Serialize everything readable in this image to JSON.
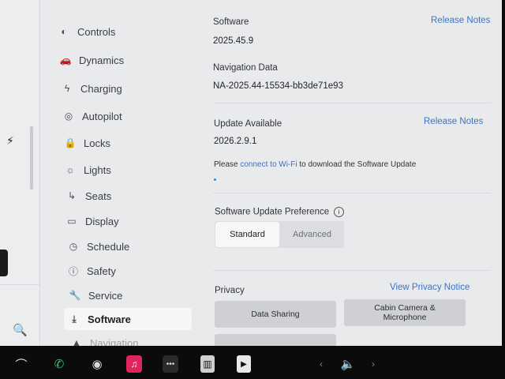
{
  "menu": {
    "items": [
      {
        "label": "Controls",
        "icon": "toggle-icon"
      },
      {
        "label": "Dynamics",
        "icon": "car-icon"
      },
      {
        "label": "Charging",
        "icon": "bolt-icon"
      },
      {
        "label": "Autopilot",
        "icon": "steering-wheel-icon"
      },
      {
        "label": "Locks",
        "icon": "lock-icon"
      },
      {
        "label": "Lights",
        "icon": "sun-icon"
      },
      {
        "label": "Seats",
        "icon": "seat-icon"
      },
      {
        "label": "Display",
        "icon": "display-icon"
      },
      {
        "label": "Schedule",
        "icon": "clock-icon"
      },
      {
        "label": "Safety",
        "icon": "info-circle-icon"
      },
      {
        "label": "Service",
        "icon": "wrench-icon"
      },
      {
        "label": "Software",
        "icon": "download-icon"
      },
      {
        "label": "Navigation",
        "icon": "navigation-icon"
      }
    ],
    "active": "Software"
  },
  "software": {
    "label": "Software",
    "version": "2025.45.9",
    "release_notes": "Release Notes"
  },
  "navigation_data": {
    "label": "Navigation Data",
    "version": "NA-2025.44-15534-bb3de71e93"
  },
  "update": {
    "label": "Update Available",
    "version": "2026.2.9.1",
    "release_notes": "Release Notes",
    "note_prefix": "Please ",
    "note_link": "connect to Wi-Fi",
    "note_suffix": " to download the Software Update"
  },
  "preference": {
    "label": "Software Update Preference",
    "options": [
      "Standard",
      "Advanced"
    ],
    "selected": "Standard"
  },
  "privacy": {
    "label": "Privacy",
    "view_notice": "View Privacy Notice",
    "buttons": [
      "Data Sharing",
      "Cabin Camera & Microphone"
    ]
  },
  "colors": {
    "accent": "#3b73c8",
    "background": "#e9eaec"
  }
}
